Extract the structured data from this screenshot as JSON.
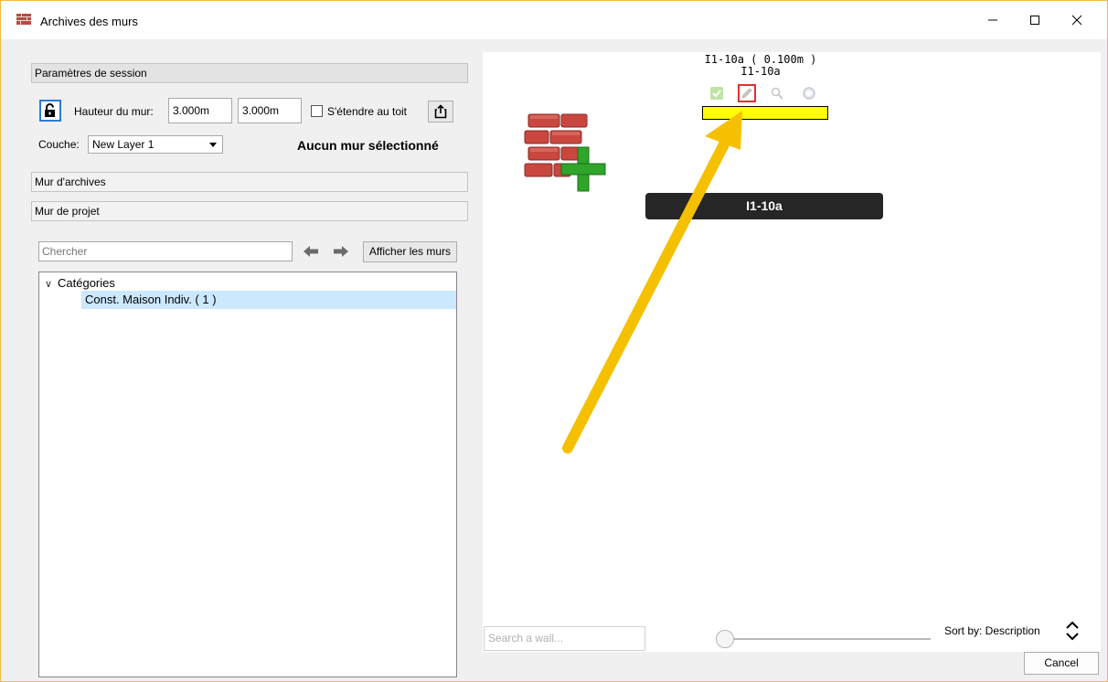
{
  "window": {
    "title": "Archives des murs",
    "minimize_icon": "minimize-icon",
    "maximize_icon": "maximize-icon",
    "close_icon": "close-icon"
  },
  "session": {
    "header": "Paramètres de session",
    "lock_icon": "padlock-open-icon",
    "height_label": "Hauteur du mur:",
    "height_value_1": "3.000m",
    "height_value_2": "3.000m",
    "extend_roof_label": "S'étendre au toit",
    "extend_roof_checked": false,
    "share_icon": "share-export-icon",
    "layer_label": "Couche:",
    "layer_value": "New Layer 1",
    "status": "Aucun mur sélectionné"
  },
  "sections": {
    "archive_wall": "Mur d'archives",
    "project_wall": "Mur de projet"
  },
  "browser": {
    "search_placeholder": "Chercher",
    "back_icon": "arrow-left-icon",
    "forward_icon": "arrow-right-icon",
    "show_walls_label": "Afficher les murs",
    "tree_root": "Catégories",
    "tree_selected_item": "Const. Maison Indiv. ( 1 )"
  },
  "preview": {
    "wall_title_line1": "I1-10a ( 0.100m )",
    "wall_title_line2": "I1-10a",
    "icons": [
      "check-icon",
      "pencil-edit-icon",
      "magnifier-icon",
      "circle-icon"
    ],
    "wall_name_pill": "I1-10a",
    "bar_color": "#ffff00",
    "arrow_color": "#f5c000",
    "highlight_color": "#e03030",
    "brick_icon": "brick-wall-add-icon"
  },
  "footer": {
    "search_wall_placeholder": "Search a wall...",
    "sort_label": "Sort by: Description",
    "sort_icon": "sort-up-down-icon",
    "cancel_label": "Cancel"
  }
}
